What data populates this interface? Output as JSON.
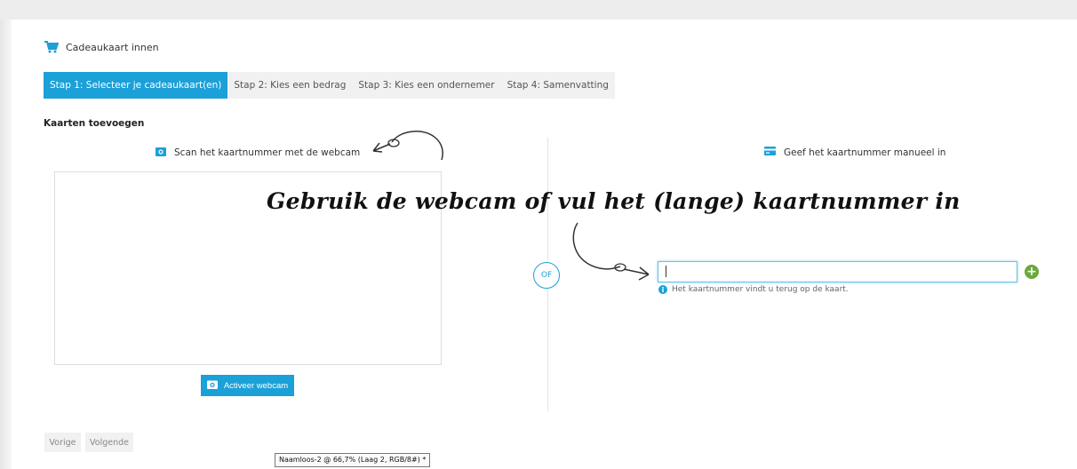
{
  "header": {
    "title": "Cadeaukaart innen",
    "cart_icon": "shopping-cart-icon",
    "accent_color": "#1ba0d8"
  },
  "steps": [
    {
      "label": "Stap 1: Selecteer je cadeaukaart(en)",
      "active": true
    },
    {
      "label": "Stap 2: Kies een bedrag",
      "active": false
    },
    {
      "label": "Stap 3: Kies een ondernemer",
      "active": false
    },
    {
      "label": "Stap 4: Samenvatting",
      "active": false
    }
  ],
  "section": {
    "title": "Kaarten toevoegen"
  },
  "scan": {
    "label": "Scan het kaartnummer met de webcam",
    "icon": "camera-icon",
    "button_label": "Activeer webcam"
  },
  "divider": {
    "or_label": "OF"
  },
  "manual": {
    "label": "Geef het kaartnummer manueel in",
    "icon": "card-icon",
    "input_value": "",
    "hint": "Het kaartnummer vindt u terug op de kaart.",
    "add_icon": "plus-circle-icon",
    "add_color": "#6aa93b"
  },
  "annotation": {
    "text": "Gebruik de webcam of vul het (lange) kaartnummer in"
  },
  "footer": {
    "prev_label": "Vorige",
    "next_label": "Volgende"
  },
  "tooltip": {
    "text": "Naamloos-2 @ 66,7% (Laag 2, RGB/8#) *"
  }
}
